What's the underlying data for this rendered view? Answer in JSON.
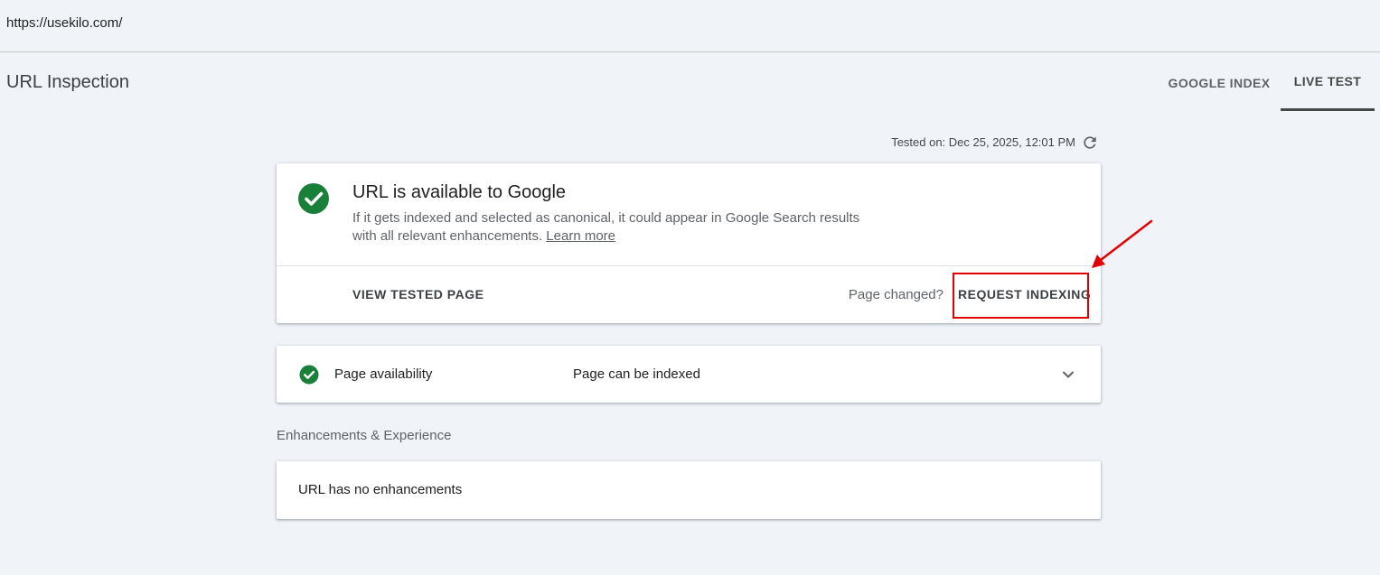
{
  "url_bar": {
    "url": "https://usekilo.com/"
  },
  "header": {
    "title": "URL Inspection",
    "tabs": [
      {
        "label": "GOOGLE INDEX",
        "active": false
      },
      {
        "label": "LIVE TEST",
        "active": true
      }
    ]
  },
  "test_info": {
    "tested_on": "Tested on: Dec 25, 2025, 12:01 PM",
    "icon": "refresh-icon"
  },
  "status_card": {
    "icon": "check-circle-icon",
    "title": "URL is available to Google",
    "description_line1": "If it gets indexed and selected as canonical, it could appear in Google Search results",
    "description_line2": "with all relevant enhancements.",
    "learn_more": "Learn more",
    "view_tested_page": "VIEW TESTED PAGE",
    "page_changed": "Page changed?",
    "request_indexing": "REQUEST INDEXING"
  },
  "availability": {
    "icon": "check-circle-icon",
    "label": "Page availability",
    "value": "Page can be indexed",
    "expand_icon": "chevron-down-icon"
  },
  "enhancements": {
    "section_label": "Enhancements & Experience",
    "message": "URL has no enhancements"
  },
  "colors": {
    "background": "#f0f4f9",
    "success_green": "#188038",
    "annotation_red": "#e00000",
    "active_tab": "#444746"
  }
}
